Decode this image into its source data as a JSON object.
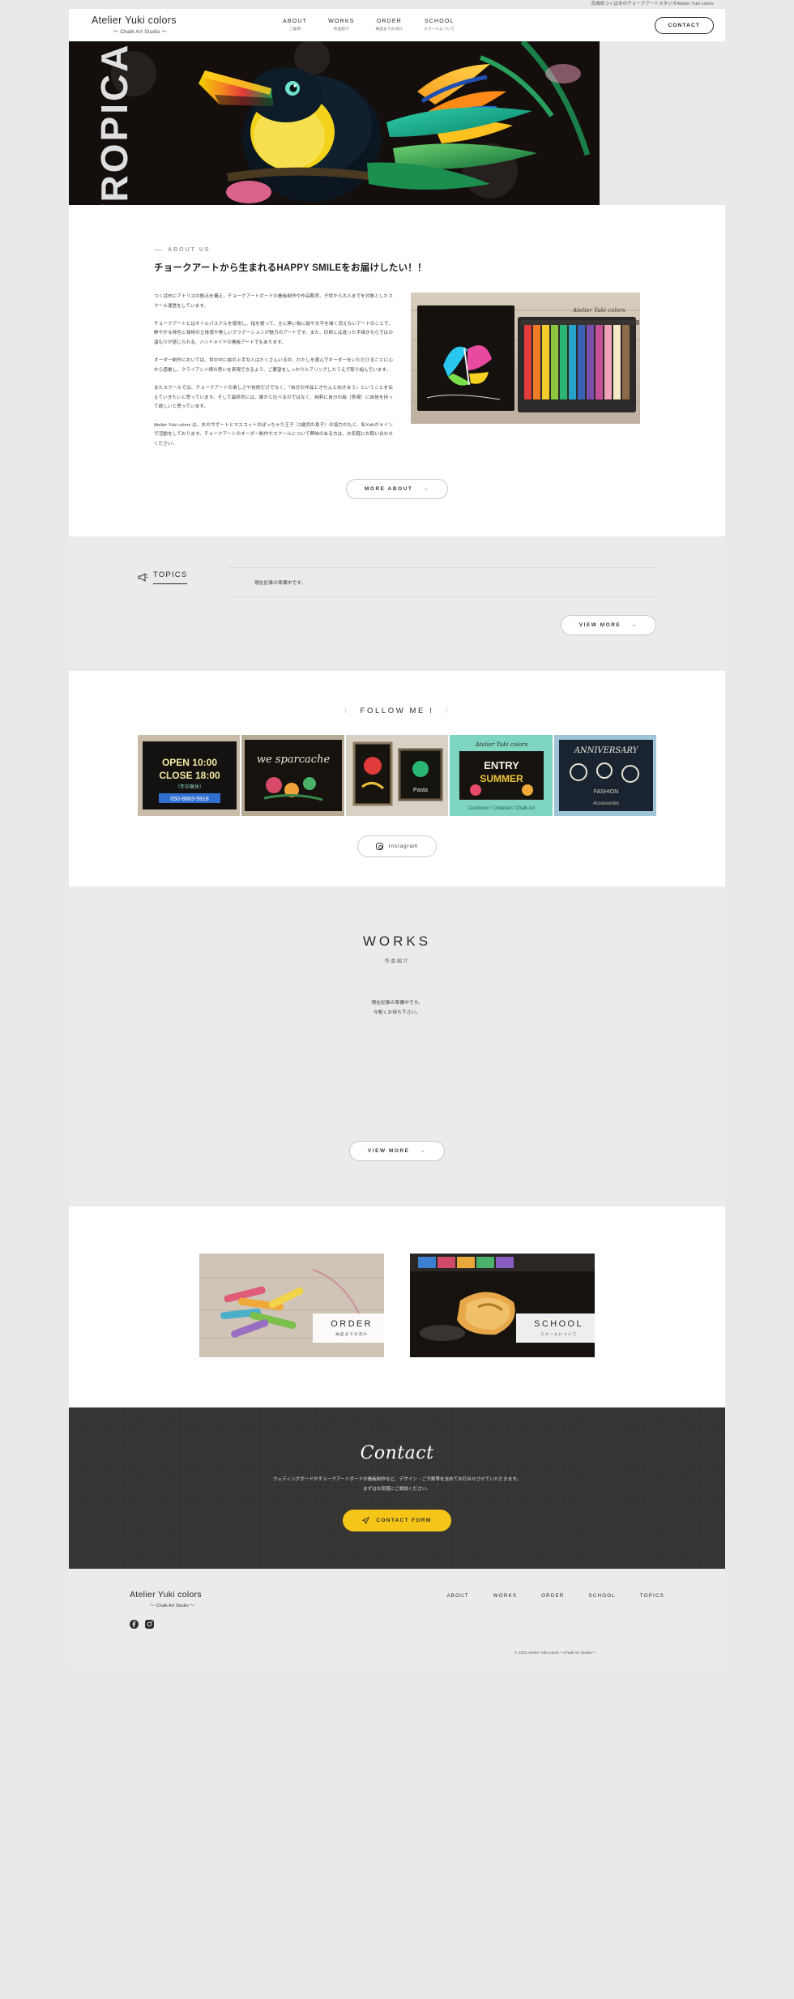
{
  "tagline": "茨城県つくば市のチョークアートスタジオAtelier Yuki colors",
  "header": {
    "brand_name": "Atelier Yuki colors",
    "brand_sub": "～ Chalk Art Studio ～",
    "nav": [
      {
        "en": "ABOUT",
        "ja": "ご挨拶"
      },
      {
        "en": "WORKS",
        "ja": "作品紹介"
      },
      {
        "en": "ORDER",
        "ja": "納品までの流れ"
      },
      {
        "en": "SCHOOL",
        "ja": "スクールについて"
      }
    ],
    "contact_label": "CONTACT"
  },
  "hero": {
    "word": "TROPICAL"
  },
  "about": {
    "eyebrow": "ABOUT US",
    "title": "チョークアートから生まれるHAPPY SMILEをお届けしたい！！",
    "paragraphs": [
      "つくば市にアトリエの拠点を構え、チョークアートボードの看板制作や作品販売、子供から大人までを対象としたスクール運営をしています。",
      "チョークアートとはオイルパステルを使用し、指を使って、主に黒い板に絵や文字を描く消えないアートのことで、鮮やかな発色と独特の立体感や美しいグラデーションが魅力のアートです。また、印刷とは違った手描きならではの温もりが感じられる、ハンドメイドの看板アートでもあります。",
      "オーダー制作においては、世の中に絵の上手な人はたくさんいる中、わたしを選んでオーダーをいただけることに心から感謝し、クライアント様の思いを表現できるよう、ご要望をしっかりヒアリングしたうえで取り組んでいます。",
      "またスクールでは、チョークアートの楽しさや技術だけでなく、『自分の作品ときちんと向き合う』ということを伝えていきたいと思っています。そして最終的には、誰かと比べるのではなく、純粋に自分の絵（表現）に自信を持って欲しいと思っています。",
      "Atelier Yuki colors は、夫のサポートとマスコットのぽっちゃり王子（2歳児の息子）の協力のもと、私Yukiがメインで活動をしております。チョークアートのオーダー制作やスクールについて興味のある方は、お気軽にお問い合わせください。"
    ],
    "more_label": "MORE ABOUT",
    "arrow": "→"
  },
  "topics": {
    "label": "TOPICS",
    "icon": "megaphone-icon",
    "items": [
      "現在記事の準備中です。"
    ],
    "view_more": "VIEW MORE",
    "arrow": "→"
  },
  "follow": {
    "title": "FOLLOW ME !",
    "left_slash": "\\",
    "right_slash": "/",
    "instagram_label": "Instagram",
    "gallery": [
      {
        "caption": "OPEN 10:00 CLOSE 18:00",
        "sub": "050-8883-5918"
      },
      {
        "caption": "we sparcache",
        "sub": ""
      },
      {
        "caption": "",
        "sub": ""
      },
      {
        "caption": "ENTRY SUMMER",
        "sub": ""
      },
      {
        "caption": "ANNIVERSARY",
        "sub": ""
      }
    ]
  },
  "works": {
    "title": "WORKS",
    "subtitle": "作品紹介",
    "empty_line1": "現在記事の準備中です。",
    "empty_line2": "今暫くお待ち下さい。",
    "view_more": "VIEW MORE",
    "arrow": "→"
  },
  "cards": [
    {
      "en": "ORDER",
      "ja": "納品までの流れ"
    },
    {
      "en": "SCHOOL",
      "ja": "スクールについて"
    }
  ],
  "contact": {
    "script_title": "Contact",
    "lead_line1": "ウェディングボードやチョークアートボードの看板制作など、デザイン・ご予算等を含めてお打合せさせていただきます。",
    "lead_line2": "まずはお気軽にご相談ください。",
    "cta_label": "CONTACT FORM",
    "cta_icon": "paper-plane-icon",
    "cta_color": "#f5c518"
  },
  "footer": {
    "brand_name": "Atelier Yuki colors",
    "brand_sub": "～ Chalk Art Studio ～",
    "socials": [
      "facebook-icon",
      "instagram-icon"
    ],
    "nav": [
      "ABOUT",
      "WORKS",
      "ORDER",
      "SCHOOL",
      "TOPICS"
    ],
    "copyright": "© 2022 Atelier Yuki colors ～Chalk Art Studio～"
  }
}
